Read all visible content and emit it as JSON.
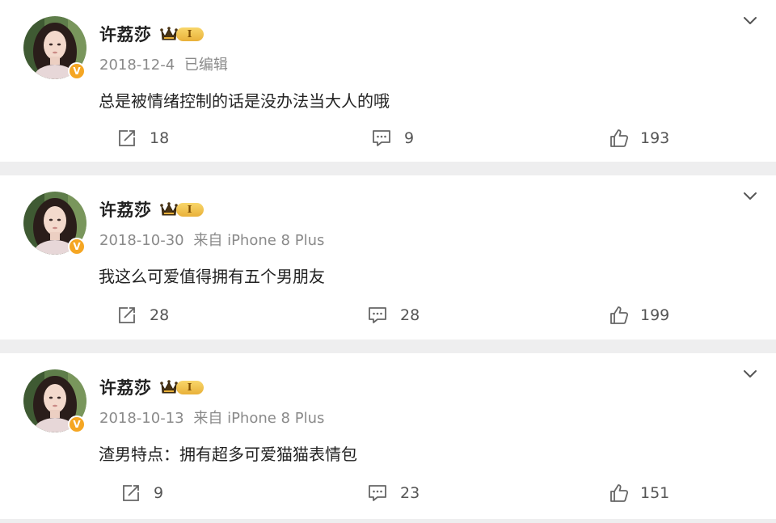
{
  "posts": [
    {
      "user": "许荔莎",
      "verified_mark": "V",
      "vip_level": "I",
      "date": "2018-12-4",
      "source": "已编辑",
      "text": "总是被情绪控制的话是没办法当大人的哦",
      "reposts": "18",
      "comments": "9",
      "likes": "193"
    },
    {
      "user": "许荔莎",
      "verified_mark": "V",
      "vip_level": "I",
      "date": "2018-10-30",
      "source": "来自 iPhone 8 Plus",
      "text": "我这么可爱值得拥有五个男朋友",
      "reposts": "28",
      "comments": "28",
      "likes": "199"
    },
    {
      "user": "许荔莎",
      "verified_mark": "V",
      "vip_level": "I",
      "date": "2018-10-13",
      "source": "来自 iPhone 8 Plus",
      "text": "渣男特点：拥有超多可爱猫猫表情包",
      "reposts": "9",
      "comments": "23",
      "likes": "151"
    }
  ],
  "icons": {
    "menu": "chevron-down-icon",
    "repost": "repost-icon",
    "comment": "comment-icon",
    "like": "thumbs-up-icon",
    "vip": "crown-icon"
  },
  "colors": {
    "verified": "#f5a623",
    "vip_gold": "#e9b13a",
    "meta_text": "#8a8a8a",
    "background": "#eeeeef"
  }
}
